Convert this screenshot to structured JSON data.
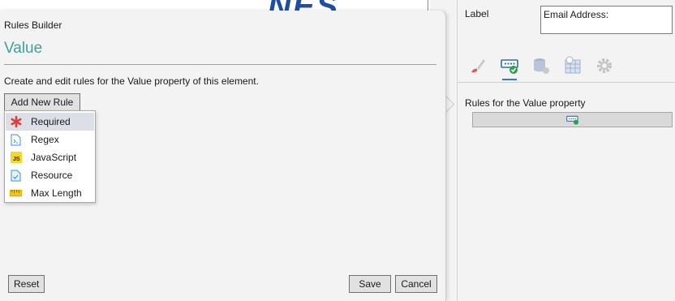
{
  "canvas": {
    "logo_text": "NES"
  },
  "properties": {
    "label_caption": "Label",
    "label_value": "Email Address:",
    "tabs": [
      {
        "icon": "paint-brush-icon",
        "active": false
      },
      {
        "icon": "validation-rules-icon",
        "active": true
      },
      {
        "icon": "database-icon",
        "active": false
      },
      {
        "icon": "calendar-grid-icon",
        "active": false
      },
      {
        "icon": "gear-icon",
        "active": false
      }
    ],
    "rules_heading": "Rules for the Value property"
  },
  "rules_builder": {
    "title": "Rules Builder",
    "heading": "Value",
    "description": "Create and edit rules for the Value property of this element.",
    "add_rule_label": "Add New Rule",
    "menu_items": [
      {
        "label": "Required",
        "icon": "asterisk-icon",
        "highlighted": true
      },
      {
        "label": "Regex",
        "icon": "regex-file-icon",
        "highlighted": false
      },
      {
        "label": "JavaScript",
        "icon": "javascript-icon",
        "highlighted": false
      },
      {
        "label": "Resource",
        "icon": "resource-file-icon",
        "highlighted": false
      },
      {
        "label": "Max Length",
        "icon": "ruler-icon",
        "highlighted": false
      }
    ],
    "reset_label": "Reset",
    "save_label": "Save",
    "cancel_label": "Cancel"
  },
  "colors": {
    "heading_teal": "#3aa39a",
    "accent_blue": "#3b78c2",
    "required_red": "#e23c3c",
    "js_yellow": "#f5d728"
  }
}
